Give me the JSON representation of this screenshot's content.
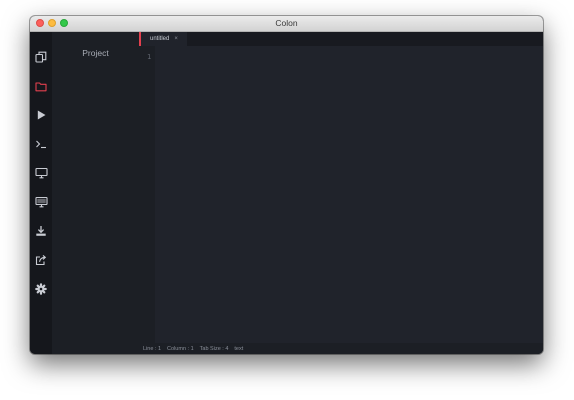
{
  "window": {
    "title": "Colon",
    "controls": [
      "close",
      "minimize",
      "zoom"
    ]
  },
  "activity_bar": {
    "items": [
      {
        "id": "workspace",
        "icon": "copy-icon",
        "color": "#c9ccd3"
      },
      {
        "id": "project",
        "icon": "folder-icon",
        "color": "#e2404e",
        "active": true
      },
      {
        "id": "run",
        "icon": "play-icon",
        "color": "#c9ccd3"
      },
      {
        "id": "terminal",
        "icon": "terminal-icon",
        "color": "#c9ccd3"
      },
      {
        "id": "preview",
        "icon": "monitor-icon",
        "color": "#c9ccd3"
      },
      {
        "id": "display",
        "icon": "display-icon",
        "color": "#c9ccd3"
      },
      {
        "id": "download",
        "icon": "download-icon",
        "color": "#c9ccd3"
      },
      {
        "id": "share",
        "icon": "share-icon",
        "color": "#c9ccd3"
      },
      {
        "id": "settings",
        "icon": "gear-icon",
        "color": "#c9ccd3"
      }
    ]
  },
  "sidebar": {
    "title": "Project"
  },
  "tabs": [
    {
      "label": "untitled",
      "close": "×",
      "active": true
    }
  ],
  "editor": {
    "line_numbers": [
      "1"
    ],
    "content": ""
  },
  "status_bar": {
    "line": "Line : 1",
    "column": "Column : 1",
    "tab_size": "Tab Size : 4",
    "mode": "text"
  },
  "colors": {
    "accent": "#e2404e",
    "editor_background": "#20232b",
    "sidebar_background": "#1c1f25",
    "activity_background": "#15171c"
  }
}
